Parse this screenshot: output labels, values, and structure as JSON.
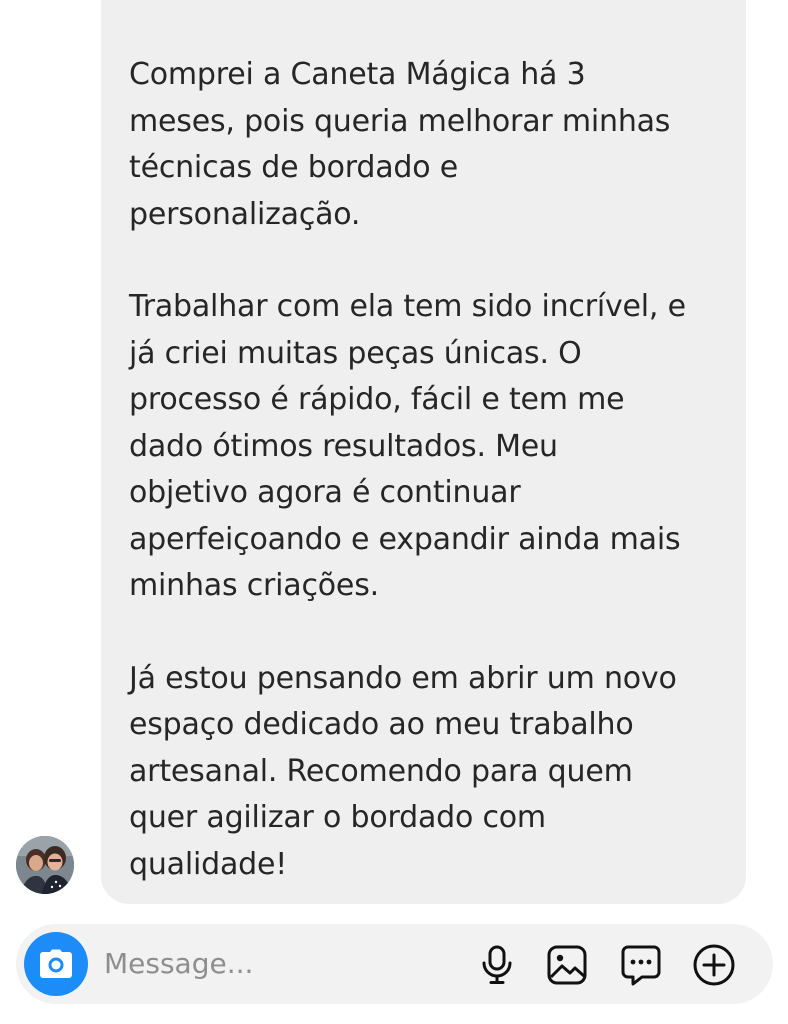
{
  "message": {
    "paragraphs": [
      {
        "lines": [
          "Comprei a Caneta Mágica há 3",
          "meses, pois queria melhorar minhas",
          "técnicas de bordado e",
          "personalização."
        ]
      },
      {
        "lines": [
          "Trabalhar com ela tem sido incrível, e",
          "já criei muitas peças únicas. O",
          "processo é rápido, fácil e tem me",
          "dado ótimos resultados. Meu",
          "objetivo agora é continuar",
          "aperfeiçoando e expandir ainda mais",
          "minhas criações."
        ]
      },
      {
        "lines": [
          "Já estou pensando em abrir um novo",
          "espaço dedicado ao meu trabalho",
          "artesanal. Recomendo para quem",
          "quer agilizar o bordado com",
          "qualidade!"
        ]
      }
    ]
  },
  "sender": {
    "avatar_icon": "profile-photo"
  },
  "composer": {
    "placeholder": "Message...",
    "camera_icon": "camera-icon",
    "mic_icon": "microphone-icon",
    "gallery_icon": "image-icon",
    "sticker_icon": "chat-bubble-icon",
    "plus_icon": "plus-circle-icon"
  },
  "colors": {
    "bubble": "#efefef",
    "text": "#262626",
    "accent": "#1d8cf8",
    "composer_bg": "#f2f2f2",
    "placeholder": "#8e8e8e"
  }
}
